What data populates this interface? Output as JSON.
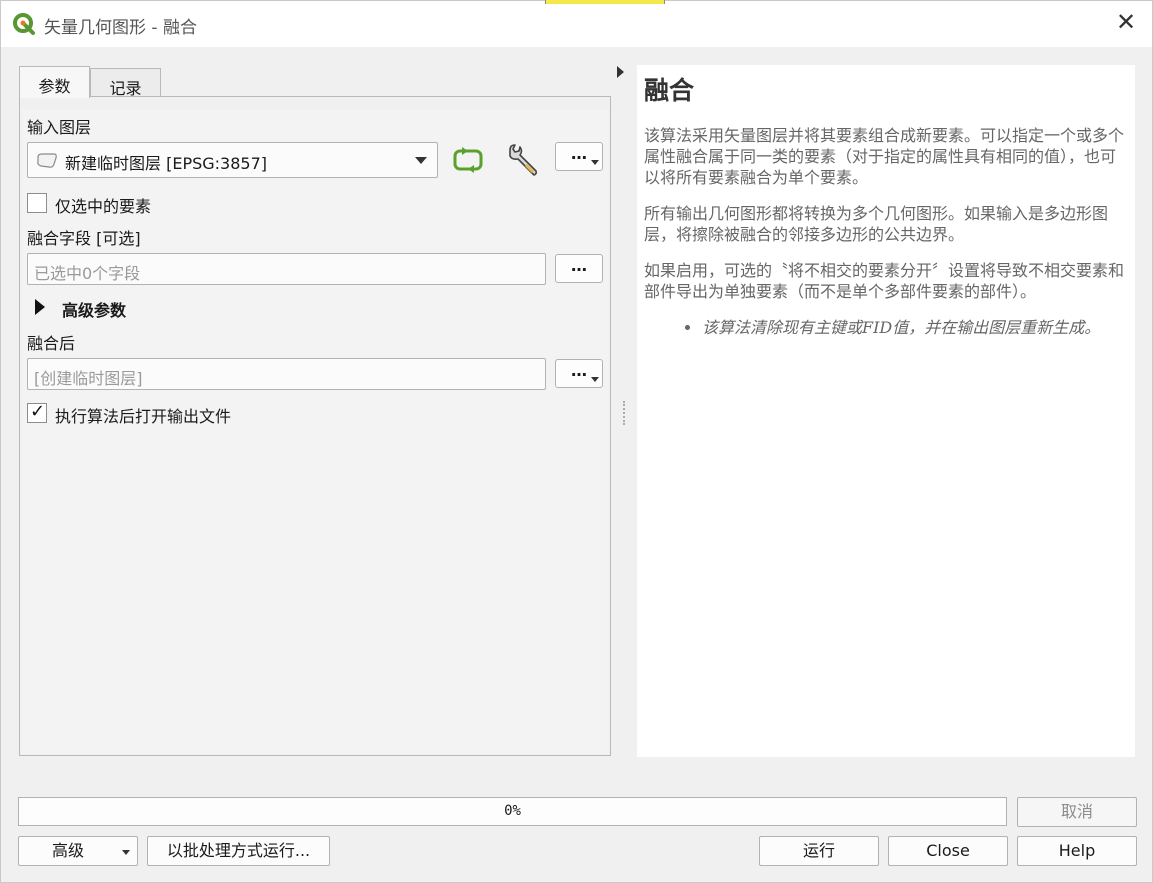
{
  "window": {
    "title": "矢量几何图形 - 融合",
    "close_glyph": "✕",
    "logo_icon": "qgis-logo-icon",
    "accent_color": "#589632"
  },
  "tabs": [
    {
      "label": "参数",
      "active": true
    },
    {
      "label": "记录",
      "active": false
    }
  ],
  "params": {
    "input_layer_label": "输入图层",
    "input_layer_value": "新建临时图层 [EPSG:3857]",
    "selected_only_label": "仅选中的要素",
    "selected_only_checked": false,
    "dissolve_field_label": "融合字段 [可选]",
    "dissolve_field_placeholder": "已选中0个字段",
    "advanced_label": "高级参数",
    "output_label": "融合后",
    "output_placeholder": "[创建临时图层]",
    "open_after_label": "执行算法后打开输出文件",
    "open_after_checked": true,
    "dots": "…",
    "check_glyph": "✓"
  },
  "help": {
    "title": "融合",
    "p1": "该算法采用矢量图层并将其要素组合成新要素。可以指定一个或多个属性融合属于同一类的要素（对于指定的属性具有相同的值），也可以将所有要素融合为单个要素。",
    "p2": "所有输出几何图形都将转换为多个几何图形。如果输入是多边形图层，将擦除被融合的邻接多边形的公共边界。",
    "p3": "如果启用，可选的〝将不相交的要素分开〞设置将导致不相交要素和部件导出为单独要素（而不是单个多部件要素的部件）。",
    "bullet": "该算法清除现有主键或FID值，并在输出图层重新生成。"
  },
  "bottom": {
    "progress_text": "0%",
    "progress_value": 0,
    "cancel_label": "取消",
    "advanced_btn_label": "高级",
    "batch_label": "以批处理方式运行...",
    "run_label": "运行",
    "close_label": "Close",
    "help_label": "Help"
  }
}
